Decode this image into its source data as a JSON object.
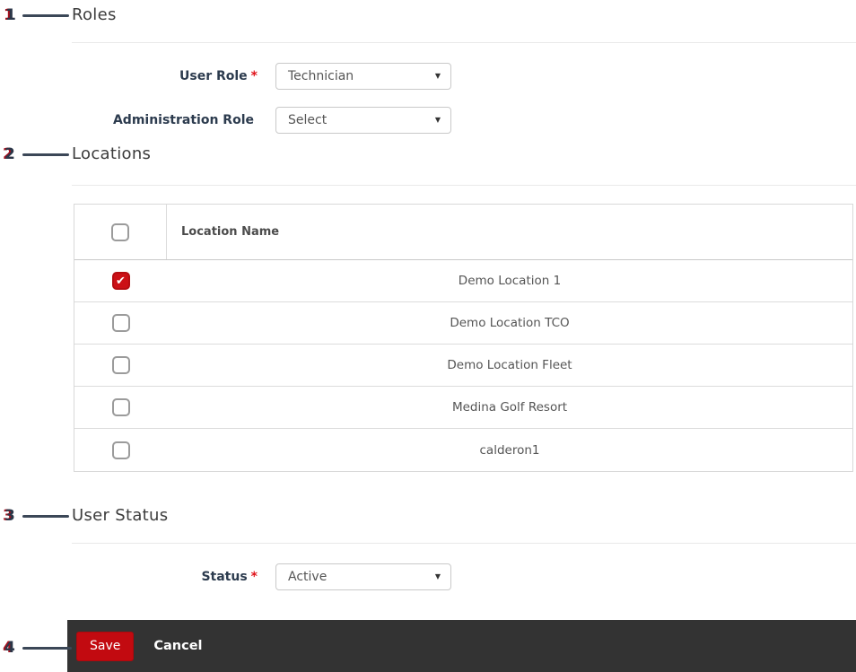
{
  "annotations": [
    {
      "number": "1",
      "points_to": "roles-section"
    },
    {
      "number": "2",
      "points_to": "locations-section"
    },
    {
      "number": "3",
      "points_to": "user-status-section"
    },
    {
      "number": "4",
      "points_to": "save-button"
    }
  ],
  "icons": {
    "checkmark": "✔",
    "dropdown_arrow": "▼"
  },
  "roles": {
    "heading": "Roles",
    "fields": [
      {
        "label": "User Role",
        "required_marker": "*",
        "value": "Technician"
      },
      {
        "label": "Administration Role",
        "value": "Select"
      }
    ]
  },
  "locations": {
    "heading": "Locations",
    "table": {
      "name_column": "Location Name",
      "rows": [
        {
          "name": "Demo Location 1",
          "checked": true
        },
        {
          "name": "Demo Location TCO",
          "checked": false
        },
        {
          "name": "Demo Location Fleet",
          "checked": false
        },
        {
          "name": "Medina Golf Resort",
          "checked": false
        },
        {
          "name": "calderon1",
          "checked": false
        }
      ]
    }
  },
  "user_status": {
    "heading": "User Status",
    "field": {
      "label": "Status",
      "required_marker": "*",
      "value": "Active"
    }
  },
  "footer": {
    "save_label": "Save",
    "cancel_label": "Cancel"
  },
  "colors": {
    "accent_red": "#c20a10",
    "checkbox_checked": "#cc1016",
    "footer_bg": "#333333",
    "annotation_line": "#3b4757"
  }
}
